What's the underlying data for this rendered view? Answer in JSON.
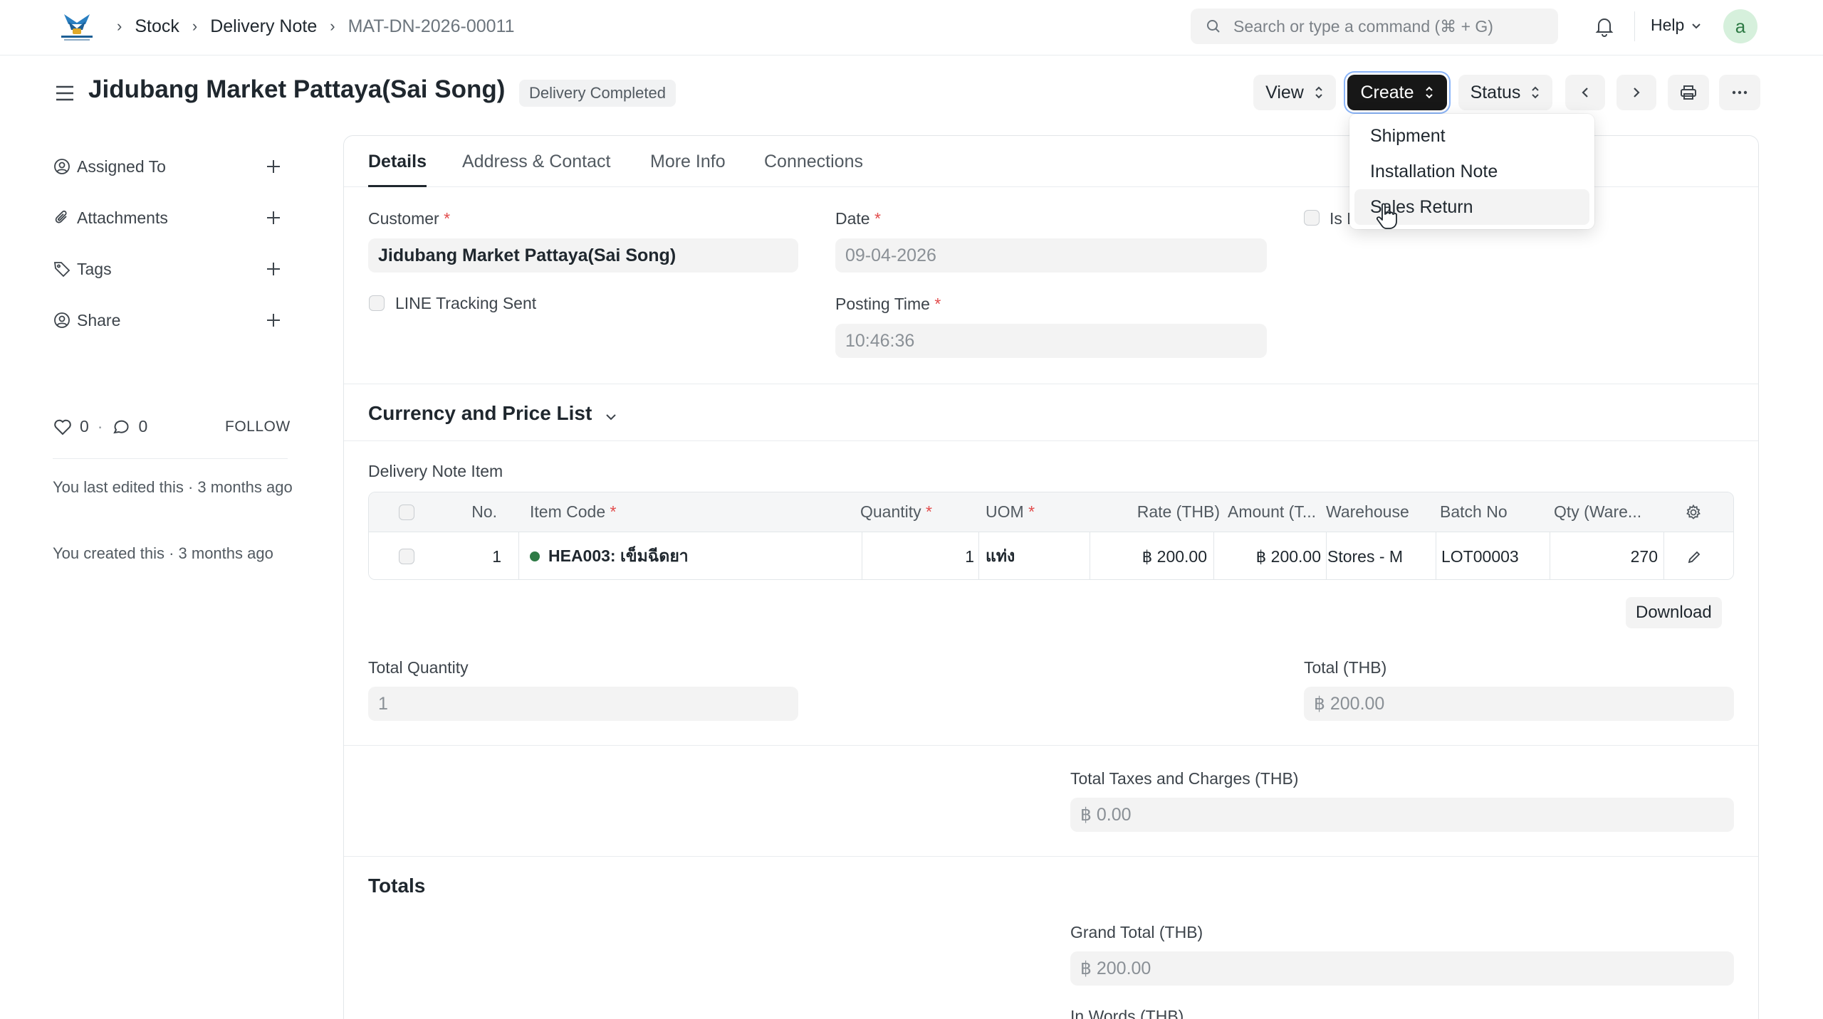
{
  "navbar": {
    "breadcrumbs": [
      "Stock",
      "Delivery Note",
      "MAT-DN-2026-00011"
    ],
    "search_placeholder": "Search or type a command (⌘ + G)",
    "help_label": "Help",
    "avatar_initial": "a"
  },
  "header": {
    "title": "Jidubang Market Pattaya(Sai Song)",
    "status": "Delivery Completed",
    "view_label": "View",
    "create_label": "Create",
    "status_label": "Status"
  },
  "create_menu": {
    "items": [
      "Shipment",
      "Installation Note",
      "Sales Return"
    ],
    "hovered": "Sales Return"
  },
  "sidebar": {
    "items": [
      {
        "label": "Assigned To"
      },
      {
        "label": "Attachments"
      },
      {
        "label": "Tags"
      },
      {
        "label": "Share"
      }
    ],
    "likes": "0",
    "comments": "0",
    "follow_label": "FOLLOW",
    "last_edited": "You last edited this · 3 months ago",
    "created": "You created this · 3 months ago"
  },
  "tabs": [
    "Details",
    "Address & Contact",
    "More Info",
    "Connections"
  ],
  "details": {
    "customer_label": "Customer",
    "customer_value": "Jidubang Market Pattaya(Sai Song)",
    "date_label": "Date",
    "date_value": "09-04-2026",
    "is_return_label": "Is R",
    "line_tracking_label": "LINE Tracking Sent",
    "posting_time_label": "Posting Time",
    "posting_time_value": "10:46:36"
  },
  "currency_section": {
    "title": "Currency and Price List"
  },
  "items_table": {
    "label": "Delivery Note Item",
    "columns": [
      "No.",
      "Item Code",
      "Quantity",
      "UOM",
      "Rate (THB)",
      "Amount (T...",
      "Warehouse",
      "Batch No",
      "Qty (Ware..."
    ],
    "rows": [
      {
        "no": "1",
        "item_code": "HEA003: เข็มฉีดยา",
        "quantity": "1",
        "uom": "แท่ง",
        "rate": "฿ 200.00",
        "amount": "฿ 200.00",
        "warehouse": "Stores - M",
        "batch_no": "LOT00003",
        "qty_warehouse": "270"
      }
    ],
    "download_label": "Download"
  },
  "totals_row": {
    "total_quantity_label": "Total Quantity",
    "total_quantity_value": "1",
    "total_label": "Total (THB)",
    "total_value": "฿ 200.00"
  },
  "taxes": {
    "label": "Total Taxes and Charges (THB)",
    "value": "฿ 0.00"
  },
  "totals_section": {
    "title": "Totals",
    "grand_total_label": "Grand Total (THB)",
    "grand_total_value": "฿ 200.00",
    "in_words_label": "In Words (THB)"
  },
  "colors": {
    "primary_button": "#171717",
    "required_asterisk": "#e24c4c",
    "stock_indicator": "#2e7a45"
  }
}
